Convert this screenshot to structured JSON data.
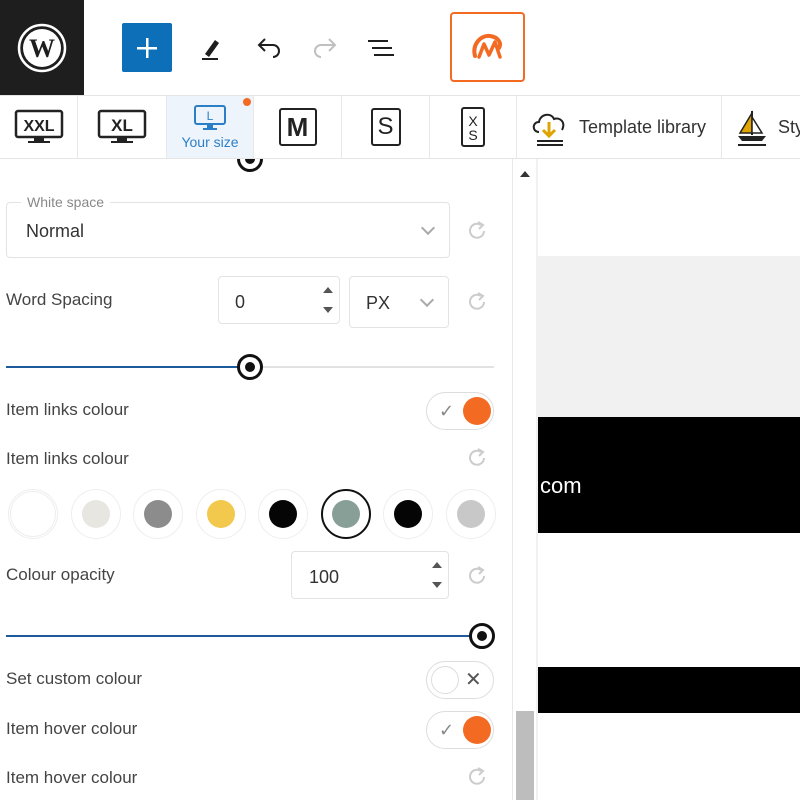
{
  "toolbar": {
    "items": [
      {
        "name": "wordpress-logo"
      },
      {
        "name": "add-block-button",
        "icon": "plus-icon"
      },
      {
        "name": "tools-button",
        "icon": "pencil-icon"
      },
      {
        "name": "undo-button",
        "icon": "undo-icon"
      },
      {
        "name": "redo-button",
        "icon": "redo-icon"
      },
      {
        "name": "document-overview-button",
        "icon": "list-view-icon"
      },
      {
        "name": "brand-plugin-button",
        "icon": "brand-logo-icon"
      }
    ],
    "accent": "#0c6fb8",
    "brand_color": "#f36a22"
  },
  "devices": {
    "tabs": [
      {
        "label": "XXL"
      },
      {
        "label": "XL"
      },
      {
        "label": "Your size",
        "icon_letter": "L",
        "active": true
      },
      {
        "label": "M"
      },
      {
        "label": "S"
      },
      {
        "label": "XS"
      }
    ],
    "template_library": "Template library",
    "styles_partial": "Sty"
  },
  "panel": {
    "white_space": {
      "legend": "White space",
      "value": "Normal"
    },
    "word_spacing": {
      "label": "Word Spacing",
      "value": "0",
      "unit": "PX"
    },
    "item_links_colour_toggle": {
      "label": "Item links colour",
      "on": true
    },
    "item_links_colour": {
      "label": "Item links colour"
    },
    "swatches": [
      {
        "name": "white",
        "color": "#ffffff"
      },
      {
        "name": "light-grey",
        "color": "#e8e6e1"
      },
      {
        "name": "grey",
        "color": "#8c8c8c"
      },
      {
        "name": "yellow",
        "color": "#f2c94c"
      },
      {
        "name": "black",
        "color": "#050505"
      },
      {
        "name": "sage",
        "color": "#889f98",
        "selected": true
      },
      {
        "name": "black-2",
        "color": "#050505"
      },
      {
        "name": "silver",
        "color": "#c8c8c8"
      }
    ],
    "colour_opacity": {
      "label": "Colour opacity",
      "value": "100"
    },
    "set_custom_colour": {
      "label": "Set custom colour",
      "on": false
    },
    "item_hover_colour_toggle": {
      "label": "Item hover colour",
      "on": true
    },
    "item_hover_colour": {
      "label": "Item hover colour"
    }
  },
  "preview": {
    "text": "com"
  }
}
